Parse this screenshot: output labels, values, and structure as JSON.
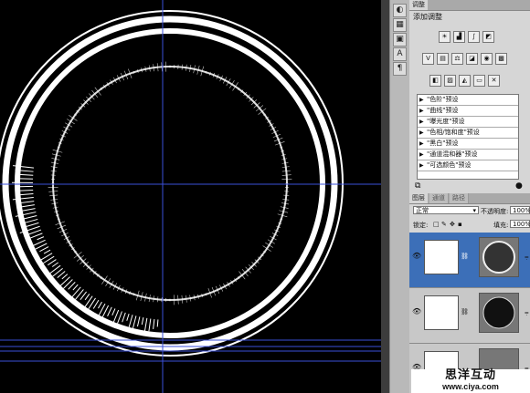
{
  "panel": {
    "adjust_tab": "调整",
    "adjust_title": "添加调整",
    "adjust_icons_row1": [
      "brightness-contrast-icon",
      "levels-icon",
      "curves-icon",
      "exposure-icon"
    ],
    "adjust_icons_row2": [
      "vibrance-icon",
      "hue-saturation-icon",
      "color-balance-icon",
      "black-white-icon",
      "photo-filter-icon",
      "channel-mixer-icon"
    ],
    "adjust_icons_row3": [
      "invert-icon",
      "posterize-icon",
      "threshold-icon",
      "gradient-map-icon",
      "selective-color-icon"
    ],
    "presets": [
      "\"色阶\"预设",
      "\"曲线\"预设",
      "\"曝光度\"预设",
      "\"色相/饱和度\"预设",
      "\"黑白\"预设",
      "\"通道混和器\"预设",
      "\"可选颜色\"预设"
    ],
    "layers_tabs": [
      "图层",
      "通道",
      "路径"
    ],
    "blend_mode": "正常",
    "opacity_label": "不透明度:",
    "opacity_value": "100%",
    "lock_label": "锁定:",
    "fill_label": "填充:",
    "fill_value": "100%",
    "layer_names": [
      "⩦",
      "⩦",
      "⩦"
    ]
  },
  "toolstrip": {
    "icons": [
      "color-icon",
      "swatches-icon",
      "styles-icon",
      "character-icon",
      "paragraph-icon"
    ]
  },
  "watermark": {
    "title": "思洋互动",
    "url": "www.ciya.com"
  }
}
